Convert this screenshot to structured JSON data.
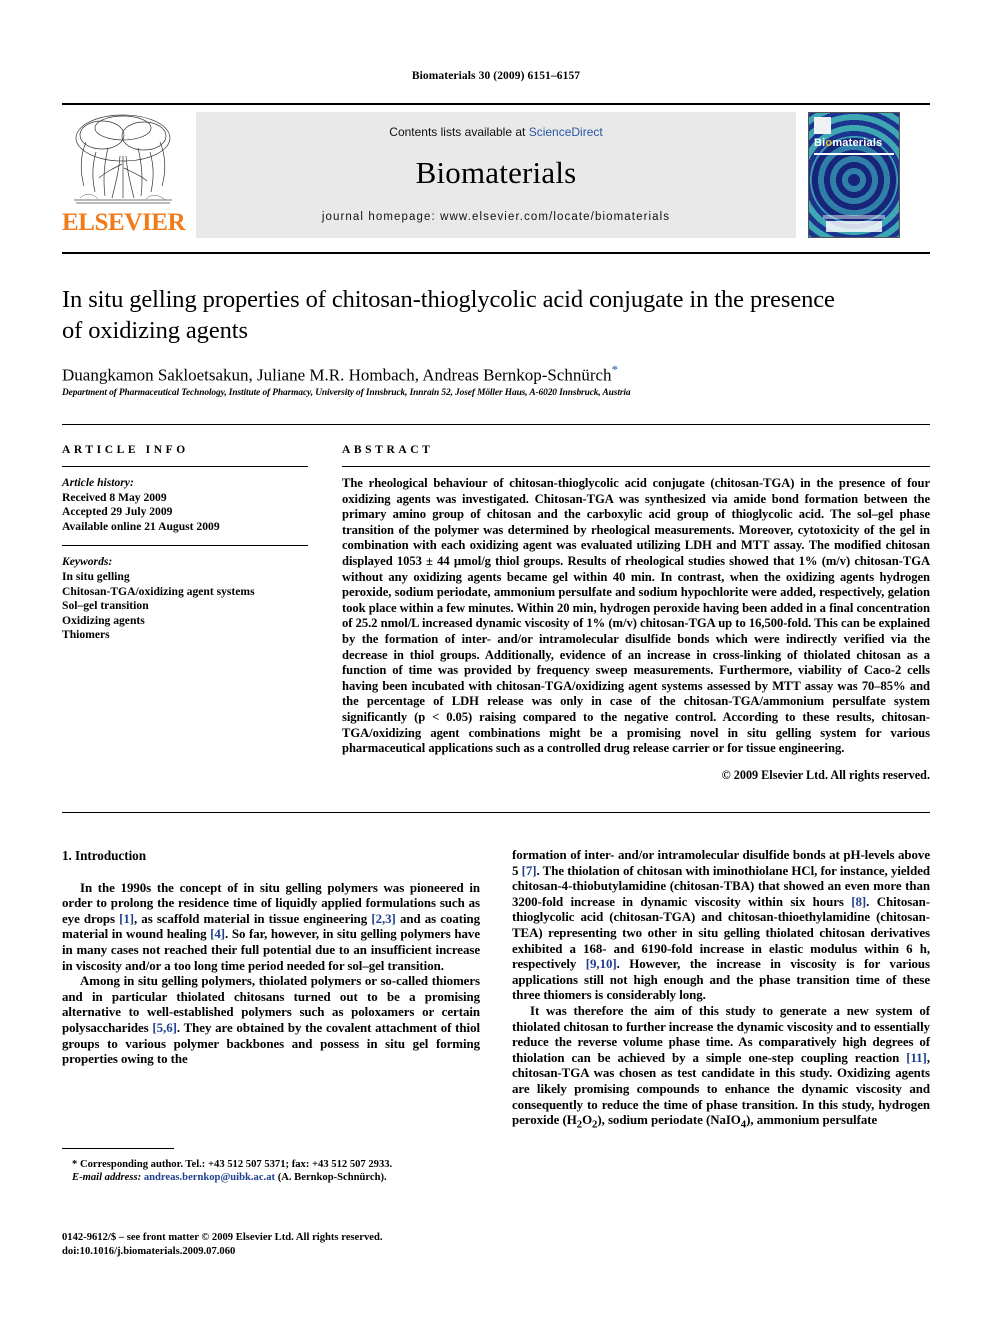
{
  "running_head": "Biomaterials 30 (2009) 6151–6157",
  "masthead": {
    "publisher": "ELSEVIER",
    "contents_prefix": "Contents lists available at ",
    "contents_link": "ScienceDirect",
    "journal_name": "Biomaterials",
    "homepage": "journal homepage: www.elsevier.com/locate/biomaterials",
    "cover_title_a": "Bi",
    "cover_title_b": "o",
    "cover_title_c": "materials"
  },
  "article": {
    "title": "In situ gelling properties of chitosan-thioglycolic acid conjugate in the presence of oxidizing agents",
    "authors": "Duangkamon Sakloetsakun, Juliane M.R. Hombach, Andreas Bernkop-Schnürch",
    "author_star": "*",
    "affiliation": "Department of Pharmaceutical Technology, Institute of Pharmacy, University of Innsbruck, Innrain 52, Josef Möller Haus, A-6020 Innsbruck, Austria"
  },
  "info": {
    "heading": "ARTICLE INFO",
    "history_label": "Article history:",
    "history": [
      "Received 8 May 2009",
      "Accepted 29 July 2009",
      "Available online 21 August 2009"
    ],
    "keywords_label": "Keywords:",
    "keywords": [
      "In situ gelling",
      "Chitosan-TGA/oxidizing agent systems",
      "Sol–gel transition",
      "Oxidizing agents",
      "Thiomers"
    ]
  },
  "abstract": {
    "heading": "ABSTRACT",
    "text": "The rheological behaviour of chitosan-thioglycolic acid conjugate (chitosan-TGA) in the presence of four oxidizing agents was investigated. Chitosan-TGA was synthesized via amide bond formation between the primary amino group of chitosan and the carboxylic acid group of thioglycolic acid. The sol–gel phase transition of the polymer was determined by rheological measurements. Moreover, cytotoxicity of the gel in combination with each oxidizing agent was evaluated utilizing LDH and MTT assay. The modified chitosan displayed 1053 ± 44 µmol/g thiol groups. Results of rheological studies showed that 1% (m/v) chitosan-TGA without any oxidizing agents became gel within 40 min. In contrast, when the oxidizing agents hydrogen peroxide, sodium periodate, ammonium persulfate and sodium hypochlorite were added, respectively, gelation took place within a few minutes. Within 20 min, hydrogen peroxide having been added in a final concentration of 25.2 nmol/L increased dynamic viscosity of 1% (m/v) chitosan-TGA up to 16,500-fold. This can be explained by the formation of inter- and/or intramolecular disulfide bonds which were indirectly verified via the decrease in thiol groups. Additionally, evidence of an increase in cross-linking of thiolated chitosan as a function of time was provided by frequency sweep measurements. Furthermore, viability of Caco-2 cells having been incubated with chitosan-TGA/oxidizing agent systems assessed by MTT assay was 70–85% and the percentage of LDH release was only in case of the chitosan-TGA/ammonium persulfate system significantly (p < 0.05) raising compared to the negative control. According to these results, chitosan-TGA/oxidizing agent combinations might be a promising novel in situ gelling system for various pharmaceutical applications such as a controlled drug release carrier or for tissue engineering.",
    "copyright": "© 2009 Elsevier Ltd. All rights reserved."
  },
  "introduction": {
    "heading": "1. Introduction",
    "left_p1_a": "In the 1990s the concept of in situ gelling polymers was pioneered in order to prolong the residence time of liquidly applied formulations such as eye drops ",
    "left_p1_r1": "[1]",
    "left_p1_b": ", as scaffold material in tissue engineering ",
    "left_p1_r2": "[2,3]",
    "left_p1_c": " and as coating material in wound healing ",
    "left_p1_r3": "[4]",
    "left_p1_d": ". So far, however, in situ gelling polymers have in many cases not reached their full potential due to an insufficient increase in viscosity and/or a too long time period needed for sol–gel transition.",
    "left_p2_a": "Among in situ gelling polymers, thiolated polymers or so-called thiomers and in particular thiolated chitosans turned out to be a promising alternative to well-established polymers such as poloxamers or certain polysaccharides ",
    "left_p2_r1": "[5,6]",
    "left_p2_b": ". They are obtained by the covalent attachment of thiol groups to various polymer backbones and possess in situ gel forming properties owing to the",
    "right_p1_a": "formation of inter- and/or intramolecular disulfide bonds at pH-levels above 5 ",
    "right_p1_r1": "[7]",
    "right_p1_b": ". The thiolation of chitosan with iminothiolane HCl, for instance, yielded chitosan-4-thiobutylamidine (chitosan-TBA) that showed an even more than 3200-fold increase in dynamic viscosity within six hours ",
    "right_p1_r2": "[8]",
    "right_p1_c": ". Chitosan-thioglycolic acid (chitosan-TGA) and chitosan-thioethylamidine (chitosan-TEA) representing two other in situ gelling thiolated chitosan derivatives exhibited a 168- and 6190-fold increase in elastic modulus within 6 h, respectively ",
    "right_p1_r3": "[9,10]",
    "right_p1_d": ". However, the increase in viscosity is for various applications still not high enough and the phase transition time of these three thiomers is considerably long.",
    "right_p2_a": "It was therefore the aim of this study to generate a new system of thiolated chitosan to further increase the dynamic viscosity and to essentially reduce the reverse volume phase time. As comparatively high degrees of thiolation can be achieved by a simple one-step coupling reaction ",
    "right_p2_r1": "[11]",
    "right_p2_b": ", chitosan-TGA was chosen as test candidate in this study. Oxidizing agents are likely promising compounds to enhance the dynamic viscosity and consequently to reduce the time of phase transition. In this study, hydrogen peroxide (H",
    "right_p2_sub1": "2",
    "right_p2_c": "O",
    "right_p2_sub2": "2",
    "right_p2_d": "), sodium periodate (NaIO",
    "right_p2_sub3": "4",
    "right_p2_e": "), ammonium persulfate"
  },
  "footnote": {
    "corresponding": "* Corresponding author. Tel.: +43 512 507 5371; fax: +43 512 507 2933.",
    "email_label": "E-mail address:",
    "email": "andreas.bernkop@uibk.ac.at",
    "email_suffix": " (A. Bernkop-Schnürch)."
  },
  "imprint": {
    "line1": "0142-9612/$ – see front matter © 2009 Elsevier Ltd. All rights reserved.",
    "line2": "doi:10.1016/j.biomaterials.2009.07.060"
  }
}
